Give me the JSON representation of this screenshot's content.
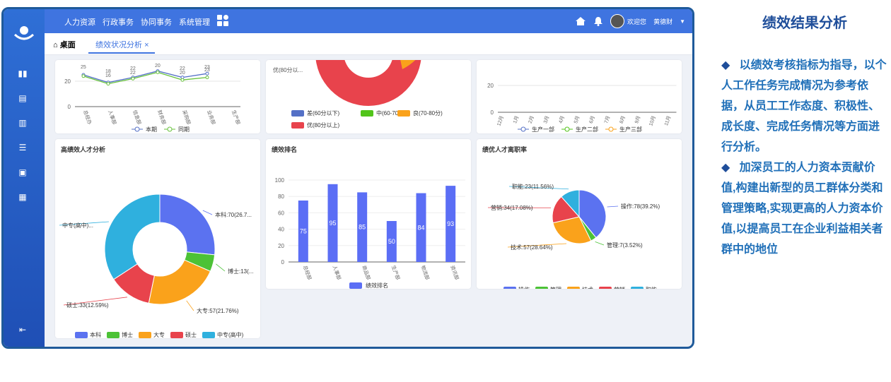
{
  "nav": {
    "menu": [
      "人力资源",
      "行政事务",
      "协同事务",
      "系统管理"
    ],
    "welcome": "欢迎您",
    "user": "黄德财"
  },
  "tabs": {
    "home": "桌面",
    "active": "绩效状况分析",
    "close": "×"
  },
  "top_line": {
    "categories": [
      "总经办",
      "人事部",
      "信息部",
      "财务部",
      "采购部",
      "业务部",
      "生产部"
    ],
    "series": [
      {
        "name": "本期",
        "values": [
          25,
          19,
          23,
          28,
          23,
          26,
          null
        ],
        "color": "#5470c6"
      },
      {
        "name": "同期",
        "values": [
          24,
          18,
          22,
          27,
          21,
          23,
          null
        ],
        "color": "#67c23a"
      }
    ],
    "labels": [
      "25",
      "18",
      "16",
      "22",
      "22",
      "20",
      "22",
      "20",
      "23",
      "23"
    ],
    "yticks": [
      "20",
      "0"
    ]
  },
  "top_pie": {
    "label": "优(80分以...",
    "legend": [
      "差(60分以下)",
      "中(60-70分)",
      "良(70-80分)",
      "优(80分以上)"
    ],
    "colors": [
      "#5470c6",
      "#52c41a",
      "#faa21b",
      "#e8434c"
    ]
  },
  "top_months": {
    "categories": [
      "12月",
      "1月",
      "2月",
      "3月",
      "4月",
      "5月",
      "6月",
      "7月",
      "8月",
      "9月",
      "10月",
      "11月"
    ],
    "yticks": [
      "20",
      "0"
    ],
    "legend": [
      "生产一部",
      "生产二部",
      "生产三部"
    ],
    "colors": [
      "#5470c6",
      "#52c41a",
      "#faa21b"
    ]
  },
  "panels": {
    "talent": "高绩效人才分析",
    "rank": "绩效排名",
    "turnover": "绩优人才离职率"
  },
  "chart_data": [
    {
      "type": "pie",
      "title": "高绩效人才分析",
      "categories": [
        "本科",
        "博士",
        "大专",
        "硕士",
        "中专(高中)"
      ],
      "values": [
        70,
        13,
        57,
        33,
        90
      ],
      "labels": [
        "本科:70(26.7...",
        "博士:13(...",
        "大专:57(21.76%)",
        "硕士:33(12.59%)",
        "中专(高中)..."
      ],
      "colors": [
        "#5b72f0",
        "#4cc236",
        "#faa21b",
        "#e8434c",
        "#2fb0de"
      ]
    },
    {
      "type": "bar",
      "title": "绩效排名",
      "categories": [
        "总经部",
        "人事部",
        "商品部",
        "生产部",
        "物流部",
        "资讯部"
      ],
      "series": [
        {
          "name": "绩效排名",
          "values": [
            75,
            95,
            85,
            50,
            84,
            93
          ]
        }
      ],
      "value_labels": [
        "75",
        "95",
        "85",
        "50",
        "84",
        "93"
      ],
      "yticks": [
        "100",
        "80",
        "60",
        "40",
        "20",
        "0"
      ],
      "ylim": [
        0,
        100
      ],
      "color": "#5b6ef5"
    },
    {
      "type": "pie",
      "title": "绩优人才离职率",
      "categories": [
        "操作",
        "管理",
        "技术",
        "营销",
        "职能"
      ],
      "values": [
        78,
        7,
        57,
        34,
        23
      ],
      "labels": [
        "操作:78(39.2%)",
        "管理:7(3.52%)",
        "技术:57(28.64%)",
        "营销:34(17.08%)",
        "职能:23(11.56%)"
      ],
      "colors": [
        "#5b72f0",
        "#4cc236",
        "#faa21b",
        "#e8434c",
        "#2fb0de"
      ]
    }
  ],
  "right": {
    "title": "绩效结果分析",
    "bullet": "◆",
    "p1": "以绩效考核指标为指导，以个人工作任务完成情况为参考依据，从员工工作态度、积极性、成长度、完成任务情况等方面进行分析。",
    "p2": "加深员工的人力资本贡献价值,构建出新型的员工群体分类和管理策略,实现更高的人力资本价值,以提高员工在企业利益相关者群中的地位"
  }
}
